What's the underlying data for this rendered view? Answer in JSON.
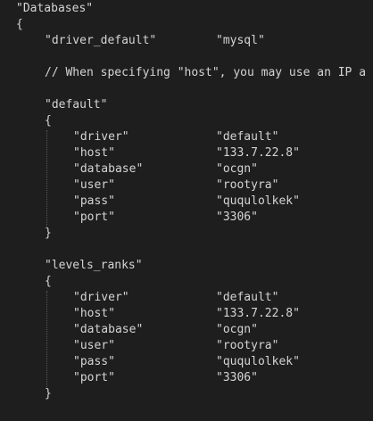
{
  "code": {
    "databases_key": "\"Databases\"",
    "open_brace": "{",
    "close_brace": "}",
    "driver_default_key": "\"driver_default\"",
    "driver_default_value": "\"mysql\"",
    "comment": "// When specifying \"host\", you may use an IP a",
    "default_block": {
      "key": "\"default\"",
      "driver_key": "\"driver\"",
      "driver_value": "\"default\"",
      "host_key": "\"host\"",
      "host_value": "\"133.7.22.8\"",
      "database_key": "\"database\"",
      "database_value": "\"ocgn\"",
      "user_key": "\"user\"",
      "user_value": "\"rootyra\"",
      "pass_key": "\"pass\"",
      "pass_value": "\"ququlolkek\"",
      "port_key": "\"port\"",
      "port_value": "\"3306\""
    },
    "levels_ranks_block": {
      "key": "\"levels_ranks\"",
      "driver_key": "\"driver\"",
      "driver_value": "\"default\"",
      "host_key": "\"host\"",
      "host_value": "\"133.7.22.8\"",
      "database_key": "\"database\"",
      "database_value": "\"ocgn\"",
      "user_key": "\"user\"",
      "user_value": "\"rootyra\"",
      "pass_key": "\"pass\"",
      "pass_value": "\"ququlolkek\"",
      "port_key": "\"port\"",
      "port_value": "\"3306\""
    }
  }
}
